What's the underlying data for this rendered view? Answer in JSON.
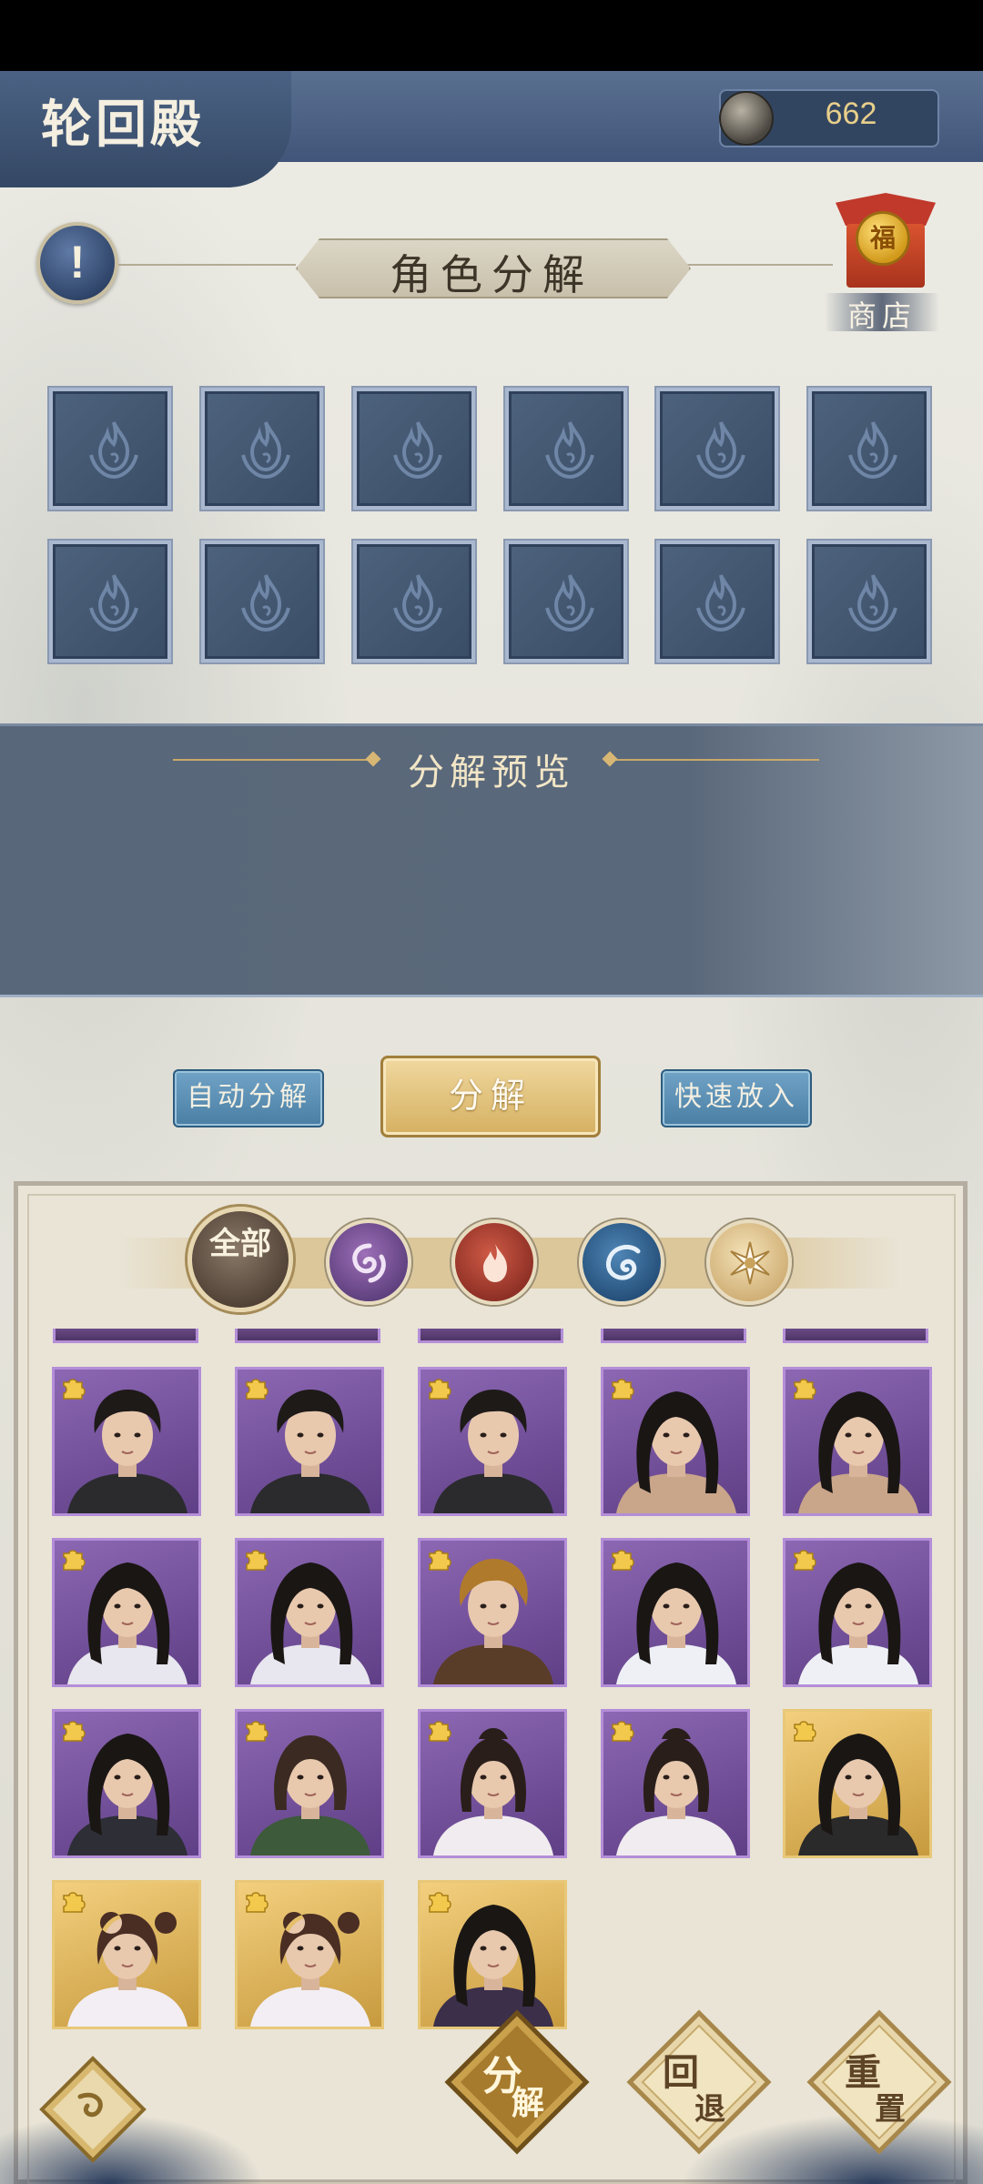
{
  "header": {
    "title": "轮回殿",
    "currency_value": "662"
  },
  "page_title": "角色分解",
  "shop": {
    "label": "商店",
    "coin_glyph": "福"
  },
  "info": {
    "glyph": "!"
  },
  "slots": {
    "rows": 2,
    "cols": 6,
    "icon": "flame-crest-icon"
  },
  "preview": {
    "title": "分解预览"
  },
  "actions": {
    "auto_label": "自动分解",
    "decompose_label": "分解",
    "quick_put_label": "快速放入"
  },
  "filters": [
    {
      "name": "全部",
      "icon": "all-filter",
      "selected": true
    },
    {
      "name": "water",
      "icon": "swirl-icon",
      "color": "#7a4f9d"
    },
    {
      "name": "fire",
      "icon": "flame-icon",
      "color": "#b2402f"
    },
    {
      "name": "wind",
      "icon": "wave-icon",
      "color": "#336a9b"
    },
    {
      "name": "light",
      "icon": "sun-icon",
      "color": "#e6cd96"
    }
  ],
  "roster": [
    [
      {
        "rarity": "purple",
        "hair": "short",
        "outfit": "#2b2b2e"
      },
      {
        "rarity": "purple",
        "hair": "short",
        "outfit": "#2b2b2e"
      },
      {
        "rarity": "purple",
        "hair": "short",
        "outfit": "#2b2b2e"
      },
      {
        "rarity": "purple",
        "hair": "long",
        "outfit": "#c9a58a"
      },
      {
        "rarity": "purple",
        "hair": "long",
        "outfit": "#c9a58a"
      }
    ],
    [
      {
        "rarity": "purple",
        "hair": "long",
        "outfit": "#e8e6ee"
      },
      {
        "rarity": "purple",
        "hair": "long",
        "outfit": "#e8e6ee"
      },
      {
        "rarity": "purple",
        "hair": "blond",
        "outfit": "#5a3d28"
      },
      {
        "rarity": "purple",
        "hair": "long",
        "outfit": "#eef0f6"
      },
      {
        "rarity": "purple",
        "hair": "long",
        "outfit": "#eef0f6"
      }
    ],
    [
      {
        "rarity": "purple",
        "hair": "long",
        "outfit": "#2e2e36"
      },
      {
        "rarity": "purple",
        "hair": "bob",
        "outfit": "#3d5a3a"
      },
      {
        "rarity": "purple",
        "hair": "updo",
        "outfit": "#f0ecef"
      },
      {
        "rarity": "purple",
        "hair": "updo",
        "outfit": "#f0ecef"
      },
      {
        "rarity": "gold",
        "hair": "long",
        "outfit": "#2a2a2a"
      }
    ],
    [
      {
        "rarity": "gold",
        "hair": "bun",
        "outfit": "#f2eef4"
      },
      {
        "rarity": "gold",
        "hair": "bun",
        "outfit": "#f2eef4"
      },
      {
        "rarity": "gold",
        "hair": "long",
        "outfit": "#3b2f4a"
      }
    ]
  ],
  "bottom": {
    "decompose": [
      "分",
      "解"
    ],
    "retreat": [
      "回",
      "退"
    ],
    "reset": [
      "重",
      "置"
    ]
  },
  "colors": {
    "header": "#3f5373",
    "gold": "#d5b061",
    "slot": "#43566f"
  }
}
